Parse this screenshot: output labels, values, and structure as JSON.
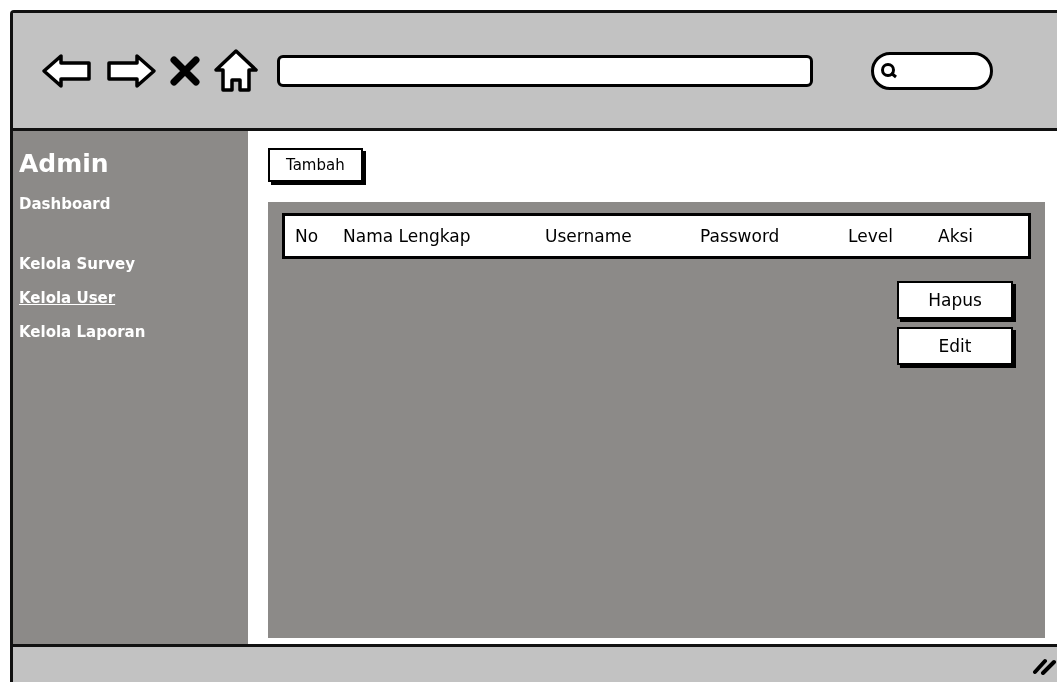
{
  "sidebar": {
    "title": "Admin",
    "groups": [
      [
        {
          "label": "Dashboard",
          "selected": false
        }
      ],
      [
        {
          "label": "Kelola Survey",
          "selected": false
        },
        {
          "label": "Kelola User",
          "selected": true
        },
        {
          "label": "Kelola Laporan",
          "selected": false
        }
      ]
    ]
  },
  "add_button": "Tambah",
  "table": {
    "columns": [
      "No",
      "Nama Lengkap",
      "Username",
      "Password",
      "Level",
      "Aksi"
    ]
  },
  "row_actions": [
    "Hapus",
    "Edit"
  ]
}
